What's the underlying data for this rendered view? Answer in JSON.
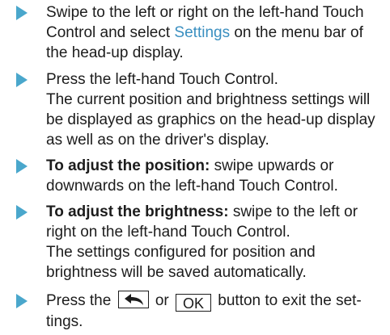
{
  "colors": {
    "bullet": "#4aa7cc",
    "link": "#3a8fc0",
    "text": "#1c1c1c"
  },
  "steps": [
    {
      "icon": "triangle-bullet-icon",
      "part1": "Swipe to the left or right on the left-hand Touch Control and select ",
      "link": "Settings",
      "part2": " on the menu bar of the head-up display."
    },
    {
      "icon": "triangle-bullet-icon",
      "line1": "Press the left-hand Touch Control.",
      "line2": "The current position and brightness settings will be displayed as graphics on the head-up display as well as on the driver's display."
    },
    {
      "icon": "triangle-bullet-icon",
      "bold": "To adjust the position:",
      "text": " swipe upwards or downwards on the left-hand Touch Control."
    },
    {
      "icon": "triangle-bullet-icon",
      "bold": "To adjust the brightness:",
      "text": " swipe to the left or right on the left-hand Touch Control.",
      "line2": "The settings configured for position and brightness will be saved automatically."
    },
    {
      "icon": "triangle-bullet-icon",
      "pre": "Press the",
      "back_icon": "back-arrow-icon",
      "mid": "or",
      "ok_label": "OK",
      "post": "button to exit the set-tings."
    }
  ]
}
